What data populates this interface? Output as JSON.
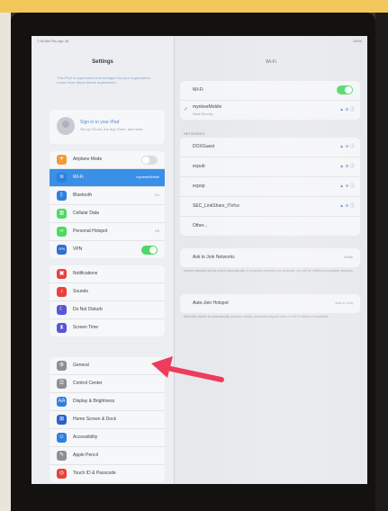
{
  "status_bar": {
    "time": "7:33 AM  Thu Apr 16",
    "battery": "100%"
  },
  "sidebar": {
    "title": "Settings",
    "note": "This iPad is supervised and managed by your organization. Learn more about device supervision...",
    "account": {
      "title": "Sign in to your iPad",
      "subtitle": "Set up iCloud, the App Store, and more."
    },
    "groups": [
      [
        {
          "icon": "airplane-icon",
          "color": "#f09a37",
          "glyph": "✈",
          "label": "Airplane Mode",
          "value": "",
          "toggle": "off"
        },
        {
          "icon": "wifi-icon",
          "color": "#2f7fe0",
          "glyph": "≋",
          "label": "Wi-Fi",
          "value": "mynkeeMobile",
          "selected": true
        },
        {
          "icon": "bluetooth-icon",
          "color": "#2f7fe0",
          "glyph": "ᛒ",
          "label": "Bluetooth",
          "value": "On"
        },
        {
          "icon": "cellular-icon",
          "color": "#4cd964",
          "glyph": "▥",
          "label": "Cellular Data",
          "value": ""
        },
        {
          "icon": "hotspot-icon",
          "color": "#4cd964",
          "glyph": "∞",
          "label": "Personal Hotspot",
          "value": "Off"
        },
        {
          "icon": "vpn-icon",
          "color": "#2f6fd0",
          "glyph": "VPN",
          "label": "VPN",
          "value": "",
          "toggle": "on"
        }
      ],
      [
        {
          "icon": "notifications-icon",
          "color": "#e8423a",
          "glyph": "▣",
          "label": "Notifications",
          "value": ""
        },
        {
          "icon": "sounds-icon",
          "color": "#e8423a",
          "glyph": "♪",
          "label": "Sounds",
          "value": ""
        },
        {
          "icon": "do-not-disturb-icon",
          "color": "#5856d6",
          "glyph": "☾",
          "label": "Do Not Disturb",
          "value": ""
        },
        {
          "icon": "screen-time-icon",
          "color": "#5856d6",
          "glyph": "⧗",
          "label": "Screen Time",
          "value": ""
        }
      ],
      [
        {
          "icon": "gear-icon",
          "color": "#8e8e93",
          "glyph": "⚙",
          "label": "General",
          "value": ""
        },
        {
          "icon": "control-center-icon",
          "color": "#8e8e93",
          "glyph": "☰",
          "label": "Control Center",
          "value": ""
        },
        {
          "icon": "display-icon",
          "color": "#2f7fe0",
          "glyph": "AA",
          "label": "Display & Brightness",
          "value": ""
        },
        {
          "icon": "home-screen-icon",
          "color": "#2f5fc8",
          "glyph": "⊞",
          "label": "Home Screen & Dock",
          "value": ""
        },
        {
          "icon": "accessibility-icon",
          "color": "#2f7fe0",
          "glyph": "☺",
          "label": "Accessibility",
          "value": ""
        },
        {
          "icon": "pencil-icon",
          "color": "#8e8e93",
          "glyph": "✎",
          "label": "Apple Pencil",
          "value": ""
        },
        {
          "icon": "touch-id-icon",
          "color": "#e8423a",
          "glyph": "◎",
          "label": "Touch ID & Passcode",
          "value": ""
        }
      ]
    ]
  },
  "detail": {
    "title": "Wi-Fi",
    "wifi_label": "Wi-Fi",
    "current_network": {
      "name": "mynkeeMobile",
      "sub": "Weak Security"
    },
    "networks_header": "NETWORKS",
    "networks": [
      {
        "name": "DOXGuest"
      },
      {
        "name": "ecpub"
      },
      {
        "name": "ecpop"
      },
      {
        "name": "SEC_LinkShare_f7efce"
      }
    ],
    "other_label": "Other...",
    "ask_label": "Ask to Join Networks",
    "ask_value": "Notify",
    "ask_note": "Known networks will be joined automatically. If no known networks are available, you will be notified of available networks.",
    "hotspot_label": "Auto-Join Hotspot",
    "hotspot_value": "Ask to Join",
    "hotspot_note": "Allow this device to automatically discover nearby personal hotspots when no Wi-Fi network is available.",
    "network_status_glyph": "▲ ≋ ⓘ"
  },
  "colors": {
    "accent": "#3a8fe6",
    "toggle_on": "#4cd964",
    "annotation_arrow": "#ee3c5a"
  }
}
